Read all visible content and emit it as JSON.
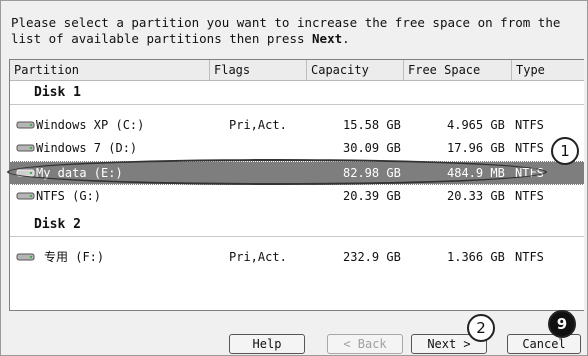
{
  "instruction": {
    "line1": "Please select a partition you want to increase the free space on from the",
    "line2_pre": "list of available partitions then press ",
    "line2_bold": "Next",
    "line2_post": "."
  },
  "columns": [
    "Partition",
    "Flags",
    "Capacity",
    "Free Space",
    "Type"
  ],
  "disks": [
    {
      "label": "Disk 1"
    },
    {
      "label": "Disk 2"
    }
  ],
  "partitions": [
    {
      "name": "Windows XP (C:)",
      "flags": "Pri,Act.",
      "capacity": "15.58 GB",
      "free": "4.965 GB",
      "type": "NTFS"
    },
    {
      "name": "Windows 7 (D:)",
      "flags": "",
      "capacity": "30.09 GB",
      "free": "17.96 GB",
      "type": "NTFS"
    },
    {
      "name": "My data (E:)",
      "flags": "",
      "capacity": "82.98 GB",
      "free": "484.9 MB",
      "type": "NTFS"
    },
    {
      "name": "NTFS (G:)",
      "flags": "",
      "capacity": "20.39 GB",
      "free": "20.33 GB",
      "type": "NTFS"
    },
    {
      "name": "专用 (F:)",
      "flags": "Pri,Act.",
      "capacity": "232.9 GB",
      "free": "1.366 GB",
      "type": "NTFS"
    }
  ],
  "buttons": {
    "help": "Help",
    "back": "< Back",
    "next": "Next >",
    "cancel": "Cancel"
  },
  "callouts": [
    "1",
    "2",
    "9"
  ],
  "colors": {
    "selected_row": "#7e7e7e",
    "window_bg": "#f0f0f0"
  }
}
